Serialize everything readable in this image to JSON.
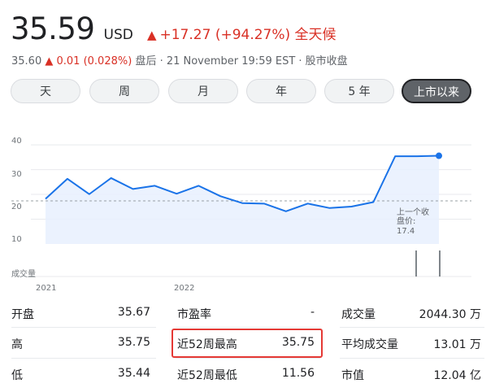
{
  "quote": {
    "price": "35.59",
    "currency": "USD",
    "change_arrow": "▲",
    "change": "+17.27 (+94.27%) 全天候",
    "after_hours_price": "35.60",
    "after_hours_arrow": "▲",
    "after_hours_change": "0.01 (0.028%)",
    "after_hours_label": "盘后 · 21 November 19:59 EST · 股市收盘"
  },
  "tabs": [
    {
      "label": "天",
      "active": false
    },
    {
      "label": "周",
      "active": false
    },
    {
      "label": "月",
      "active": false
    },
    {
      "label": "年",
      "active": false
    },
    {
      "label": "5 年",
      "active": false
    },
    {
      "label": "上市以来",
      "active": true
    }
  ],
  "chart_data": {
    "type": "line",
    "y_ticks": [
      "40",
      "30",
      "20",
      "10"
    ],
    "ylim": [
      0,
      42
    ],
    "x_ticks": [
      "2021",
      "2022"
    ],
    "volume_label": "成交量",
    "prev_close_label_1": "上一个收",
    "prev_close_label_2": "盘价:",
    "prev_close_value": "17.4",
    "prev_close": 17.4,
    "series": [
      {
        "values": [
          18.2,
          26.3,
          20.1,
          26.6,
          22.2,
          23.5,
          20.3,
          23.5,
          19.3,
          16.5,
          16.3,
          13.2,
          16.3,
          14.5,
          15.1,
          16.9,
          35.4,
          35.4,
          35.59
        ]
      }
    ],
    "accent_color": "#1a73e8",
    "fill_color": "#e8f0fe"
  },
  "stats": {
    "col1": [
      {
        "label": "开盘",
        "value": "35.67"
      },
      {
        "label": "高",
        "value": "35.75"
      },
      {
        "label": "低",
        "value": "35.44"
      }
    ],
    "col2": [
      {
        "label": "市盈率",
        "value": "-"
      },
      {
        "label": "近52周最高",
        "value": "35.75"
      },
      {
        "label": "近52周最低",
        "value": "11.56"
      }
    ],
    "col3": [
      {
        "label": "成交量",
        "value": "2044.30 万"
      },
      {
        "label": "平均成交量",
        "value": "13.01 万"
      },
      {
        "label": "市值",
        "value": "12.04 亿"
      }
    ]
  }
}
